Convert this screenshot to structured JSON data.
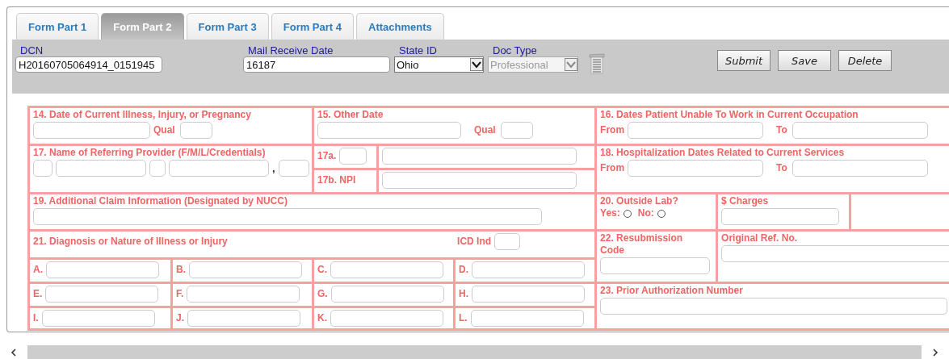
{
  "tabs": [
    {
      "label": "Form Part 1",
      "selected": false
    },
    {
      "label": "Form Part 2",
      "selected": true
    },
    {
      "label": "Form Part 3",
      "selected": false
    },
    {
      "label": "Form Part 4",
      "selected": false
    },
    {
      "label": "Attachments",
      "selected": false
    }
  ],
  "header": {
    "dcn": {
      "label": "DCN",
      "value": "H20160705064914_0151945"
    },
    "mail_receive_date": {
      "label": "Mail Receive Date",
      "value": "16187"
    },
    "state_id": {
      "label": "State ID",
      "value": "Ohio",
      "disabled": false
    },
    "doc_type": {
      "label": "Doc Type",
      "value": "Professional",
      "disabled": true
    }
  },
  "buttons": [
    "Submit",
    "Save",
    "Delete"
  ],
  "form": {
    "box14": {
      "label": "14. Date of Current Illness, Injury, or Pregnancy",
      "qual_label": "Qual"
    },
    "box15": {
      "label": "15. Other Date",
      "qual_label": "Qual"
    },
    "box16": {
      "label": "16. Dates Patient Unable To Work in Current Occupation",
      "from_label": "From",
      "to_label": "To"
    },
    "box17": {
      "label": "17. Name of Referring Provider (F/M/L/Credentials)",
      "separator": ","
    },
    "box17a": {
      "label": "17a."
    },
    "box17b": {
      "label": "17b. NPI"
    },
    "box18": {
      "label": "18. Hospitalization Dates Related to Current Services",
      "from_label": "From",
      "to_label": "To"
    },
    "box19": {
      "label": "19. Additional Claim Information (Designated by NUCC)"
    },
    "box20": {
      "label": "20. Outside Lab?",
      "options": [
        {
          "label": "Yes:",
          "selected": false
        },
        {
          "label": "No:",
          "selected": false
        }
      ]
    },
    "charges": {
      "label": "$ Charges"
    },
    "box21": {
      "label": "21. Diagnosis or Nature of Illness or Injury",
      "icd_label": "ICD Ind"
    },
    "box22": {
      "label": "22. Resubmission Code"
    },
    "original_ref": {
      "label": "Original Ref. No."
    },
    "box23": {
      "label": "23. Prior Authorization Number"
    },
    "diagnosis_rows": [
      {
        "codes": [
          {
            "label": "A."
          },
          {
            "label": "B."
          },
          {
            "label": "C."
          },
          {
            "label": "D."
          }
        ]
      },
      {
        "codes": [
          {
            "label": "E."
          },
          {
            "label": "F."
          },
          {
            "label": "G."
          },
          {
            "label": "H."
          }
        ]
      },
      {
        "codes": [
          {
            "label": "I."
          },
          {
            "label": "J."
          },
          {
            "label": "K."
          },
          {
            "label": "L."
          }
        ]
      }
    ]
  }
}
